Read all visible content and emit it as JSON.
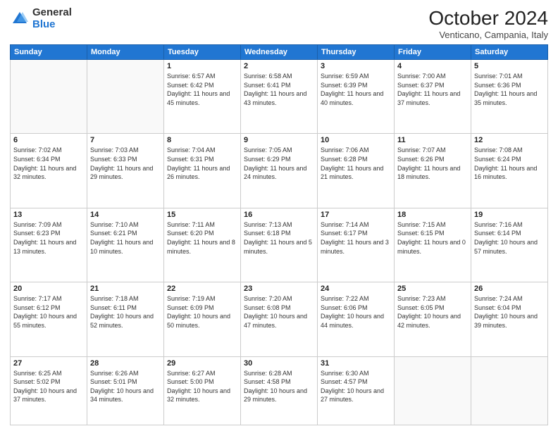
{
  "header": {
    "logo_general": "General",
    "logo_blue": "Blue",
    "month_title": "October 2024",
    "subtitle": "Venticano, Campania, Italy"
  },
  "weekdays": [
    "Sunday",
    "Monday",
    "Tuesday",
    "Wednesday",
    "Thursday",
    "Friday",
    "Saturday"
  ],
  "weeks": [
    [
      {
        "day": "",
        "sunrise": "",
        "sunset": "",
        "daylight": ""
      },
      {
        "day": "",
        "sunrise": "",
        "sunset": "",
        "daylight": ""
      },
      {
        "day": "1",
        "sunrise": "Sunrise: 6:57 AM",
        "sunset": "Sunset: 6:42 PM",
        "daylight": "Daylight: 11 hours and 45 minutes."
      },
      {
        "day": "2",
        "sunrise": "Sunrise: 6:58 AM",
        "sunset": "Sunset: 6:41 PM",
        "daylight": "Daylight: 11 hours and 43 minutes."
      },
      {
        "day": "3",
        "sunrise": "Sunrise: 6:59 AM",
        "sunset": "Sunset: 6:39 PM",
        "daylight": "Daylight: 11 hours and 40 minutes."
      },
      {
        "day": "4",
        "sunrise": "Sunrise: 7:00 AM",
        "sunset": "Sunset: 6:37 PM",
        "daylight": "Daylight: 11 hours and 37 minutes."
      },
      {
        "day": "5",
        "sunrise": "Sunrise: 7:01 AM",
        "sunset": "Sunset: 6:36 PM",
        "daylight": "Daylight: 11 hours and 35 minutes."
      }
    ],
    [
      {
        "day": "6",
        "sunrise": "Sunrise: 7:02 AM",
        "sunset": "Sunset: 6:34 PM",
        "daylight": "Daylight: 11 hours and 32 minutes."
      },
      {
        "day": "7",
        "sunrise": "Sunrise: 7:03 AM",
        "sunset": "Sunset: 6:33 PM",
        "daylight": "Daylight: 11 hours and 29 minutes."
      },
      {
        "day": "8",
        "sunrise": "Sunrise: 7:04 AM",
        "sunset": "Sunset: 6:31 PM",
        "daylight": "Daylight: 11 hours and 26 minutes."
      },
      {
        "day": "9",
        "sunrise": "Sunrise: 7:05 AM",
        "sunset": "Sunset: 6:29 PM",
        "daylight": "Daylight: 11 hours and 24 minutes."
      },
      {
        "day": "10",
        "sunrise": "Sunrise: 7:06 AM",
        "sunset": "Sunset: 6:28 PM",
        "daylight": "Daylight: 11 hours and 21 minutes."
      },
      {
        "day": "11",
        "sunrise": "Sunrise: 7:07 AM",
        "sunset": "Sunset: 6:26 PM",
        "daylight": "Daylight: 11 hours and 18 minutes."
      },
      {
        "day": "12",
        "sunrise": "Sunrise: 7:08 AM",
        "sunset": "Sunset: 6:24 PM",
        "daylight": "Daylight: 11 hours and 16 minutes."
      }
    ],
    [
      {
        "day": "13",
        "sunrise": "Sunrise: 7:09 AM",
        "sunset": "Sunset: 6:23 PM",
        "daylight": "Daylight: 11 hours and 13 minutes."
      },
      {
        "day": "14",
        "sunrise": "Sunrise: 7:10 AM",
        "sunset": "Sunset: 6:21 PM",
        "daylight": "Daylight: 11 hours and 10 minutes."
      },
      {
        "day": "15",
        "sunrise": "Sunrise: 7:11 AM",
        "sunset": "Sunset: 6:20 PM",
        "daylight": "Daylight: 11 hours and 8 minutes."
      },
      {
        "day": "16",
        "sunrise": "Sunrise: 7:13 AM",
        "sunset": "Sunset: 6:18 PM",
        "daylight": "Daylight: 11 hours and 5 minutes."
      },
      {
        "day": "17",
        "sunrise": "Sunrise: 7:14 AM",
        "sunset": "Sunset: 6:17 PM",
        "daylight": "Daylight: 11 hours and 3 minutes."
      },
      {
        "day": "18",
        "sunrise": "Sunrise: 7:15 AM",
        "sunset": "Sunset: 6:15 PM",
        "daylight": "Daylight: 11 hours and 0 minutes."
      },
      {
        "day": "19",
        "sunrise": "Sunrise: 7:16 AM",
        "sunset": "Sunset: 6:14 PM",
        "daylight": "Daylight: 10 hours and 57 minutes."
      }
    ],
    [
      {
        "day": "20",
        "sunrise": "Sunrise: 7:17 AM",
        "sunset": "Sunset: 6:12 PM",
        "daylight": "Daylight: 10 hours and 55 minutes."
      },
      {
        "day": "21",
        "sunrise": "Sunrise: 7:18 AM",
        "sunset": "Sunset: 6:11 PM",
        "daylight": "Daylight: 10 hours and 52 minutes."
      },
      {
        "day": "22",
        "sunrise": "Sunrise: 7:19 AM",
        "sunset": "Sunset: 6:09 PM",
        "daylight": "Daylight: 10 hours and 50 minutes."
      },
      {
        "day": "23",
        "sunrise": "Sunrise: 7:20 AM",
        "sunset": "Sunset: 6:08 PM",
        "daylight": "Daylight: 10 hours and 47 minutes."
      },
      {
        "day": "24",
        "sunrise": "Sunrise: 7:22 AM",
        "sunset": "Sunset: 6:06 PM",
        "daylight": "Daylight: 10 hours and 44 minutes."
      },
      {
        "day": "25",
        "sunrise": "Sunrise: 7:23 AM",
        "sunset": "Sunset: 6:05 PM",
        "daylight": "Daylight: 10 hours and 42 minutes."
      },
      {
        "day": "26",
        "sunrise": "Sunrise: 7:24 AM",
        "sunset": "Sunset: 6:04 PM",
        "daylight": "Daylight: 10 hours and 39 minutes."
      }
    ],
    [
      {
        "day": "27",
        "sunrise": "Sunrise: 6:25 AM",
        "sunset": "Sunset: 5:02 PM",
        "daylight": "Daylight: 10 hours and 37 minutes."
      },
      {
        "day": "28",
        "sunrise": "Sunrise: 6:26 AM",
        "sunset": "Sunset: 5:01 PM",
        "daylight": "Daylight: 10 hours and 34 minutes."
      },
      {
        "day": "29",
        "sunrise": "Sunrise: 6:27 AM",
        "sunset": "Sunset: 5:00 PM",
        "daylight": "Daylight: 10 hours and 32 minutes."
      },
      {
        "day": "30",
        "sunrise": "Sunrise: 6:28 AM",
        "sunset": "Sunset: 4:58 PM",
        "daylight": "Daylight: 10 hours and 29 minutes."
      },
      {
        "day": "31",
        "sunrise": "Sunrise: 6:30 AM",
        "sunset": "Sunset: 4:57 PM",
        "daylight": "Daylight: 10 hours and 27 minutes."
      },
      {
        "day": "",
        "sunrise": "",
        "sunset": "",
        "daylight": ""
      },
      {
        "day": "",
        "sunrise": "",
        "sunset": "",
        "daylight": ""
      }
    ]
  ]
}
